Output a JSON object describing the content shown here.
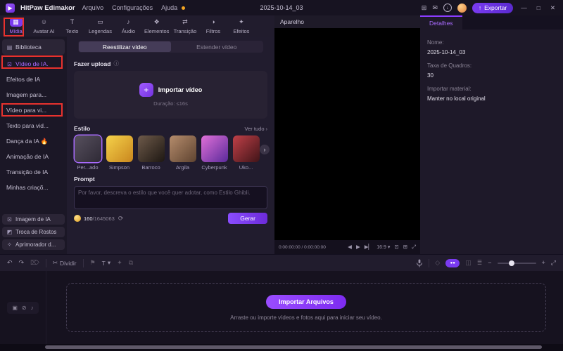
{
  "colors": {
    "accent": "#8b3dff",
    "annotation": "#e8322e",
    "export_button": "#6c3bd8"
  },
  "titlebar": {
    "app_name": "HitPaw Edimakor",
    "menu_items": [
      {
        "label": "Arquivo"
      },
      {
        "label": "Configurações"
      },
      {
        "label": "Ajuda"
      }
    ],
    "project_name": "2025-10-14_03",
    "export_label": "Exportar",
    "glyphs": {
      "logo": "▶",
      "grid": "⊞",
      "feedback": "✉",
      "download": "↓",
      "export_arrow": "↑",
      "minimize": "—",
      "maximize": "□",
      "close": "✕"
    }
  },
  "ribbon": {
    "tabs": [
      {
        "label": "Mídia",
        "glyph": "▦"
      },
      {
        "label": "Avatar AI",
        "glyph": "☺"
      },
      {
        "label": "Texto",
        "glyph": "T"
      },
      {
        "label": "Legendas",
        "glyph": "▭"
      },
      {
        "label": "Áudio",
        "glyph": "♪"
      },
      {
        "label": "Elementos",
        "glyph": "❖"
      },
      {
        "label": "Transição",
        "glyph": "⇄"
      },
      {
        "label": "Filtros",
        "glyph": "◑"
      },
      {
        "label": "Efeitos",
        "glyph": "✦"
      }
    ]
  },
  "sidebar": {
    "items": [
      {
        "label": "Biblioteca",
        "glyph": "▤"
      },
      {
        "label": "Vídeo de IA.",
        "glyph": "⊡"
      },
      {
        "label": "Efeitos de IA",
        "glyph": ""
      },
      {
        "label": "Imagem para...",
        "glyph": ""
      },
      {
        "label": "Vídeo para vi...",
        "glyph": ""
      },
      {
        "label": "Texto para vid...",
        "glyph": ""
      },
      {
        "label": "Dança da IA 🔥",
        "glyph": ""
      },
      {
        "label": "Animação de IA",
        "glyph": ""
      },
      {
        "label": "Transição de IA",
        "glyph": ""
      },
      {
        "label": "Minhas criaçõ...",
        "glyph": ""
      }
    ],
    "bottom_items": [
      {
        "label": "Imagem de IA",
        "glyph": "⊡"
      },
      {
        "label": "Troca de Rostos",
        "glyph": "◩"
      },
      {
        "label": "Aprimorador d...",
        "glyph": "✧"
      }
    ]
  },
  "panel": {
    "tabs": [
      {
        "label": "Reestilizar vídeo"
      },
      {
        "label": "Estender vídeo"
      }
    ],
    "upload_section": "Fazer upload",
    "info_glyph": "ⓘ",
    "import_video_label": "Importar vídeo",
    "plus_glyph": "+",
    "duration_hint": "Duração: ≤16s",
    "style_section": "Estilo",
    "see_all_label": "Ver tudo",
    "chevron_glyph": "›",
    "styles": [
      {
        "name": "Per...ado",
        "css": "background:linear-gradient(135deg,#57505e,#2e2935)"
      },
      {
        "name": "Simpson",
        "css": "background:linear-gradient(135deg,#f5d24a,#c9861e)"
      },
      {
        "name": "Barroco",
        "css": "background:linear-gradient(135deg,#6e5a4a,#1d1712)"
      },
      {
        "name": "Argila",
        "css": "background:linear-gradient(135deg,#b58c6c,#5e4330)"
      },
      {
        "name": "Cyberpunk",
        "css": "background:linear-gradient(135deg,#e070d8,#5a2a9a)"
      },
      {
        "name": "Uko...",
        "css": "background:linear-gradient(135deg,#c04048,#401418)"
      }
    ],
    "prompt_section": "Prompt",
    "prompt_placeholder": "Por favor, descreva o estilo que você quer adotar, como Estilo Ghibli.",
    "credits_used": "160",
    "credits_total": "/1645063",
    "refresh_glyph": "⟳",
    "generate_label": "Gerar"
  },
  "preview": {
    "title": "Aparelho",
    "timecode": "0:00:00:00 / 0:00:00:00",
    "glyphs": {
      "prev": "◀",
      "play": "▶",
      "next": "▶▏",
      "dropdown": "▾",
      "snapshot": "⊡",
      "grid": "⊞",
      "fullscreen": "⤢"
    },
    "aspect_label": "16:9"
  },
  "details": {
    "tab_label": "Detalhes",
    "fields": [
      {
        "label": "Nome:",
        "value": "2025-10-14_03"
      },
      {
        "label": "Taxa de Quadros:",
        "value": "30"
      },
      {
        "label": "Importar material:",
        "value": "Manter no local original"
      }
    ]
  },
  "timeline_toolbar": {
    "glyphs": {
      "undo": "↶",
      "redo": "↷",
      "trash": "⌦",
      "scissors": "✂",
      "flag": "⚑",
      "text_tool": "T",
      "dropdown": "▾",
      "magic": "✦",
      "crop": "⧉",
      "keyframe": "◇",
      "toggle_a": "●●",
      "track_view": "◫",
      "list_view": "≣",
      "zoom_out": "−",
      "zoom_in": "+",
      "fit": "⤢"
    },
    "split_label": "Dividir"
  },
  "timeline": {
    "track_glyphs": {
      "record": "▣",
      "mute": "⊘",
      "audio": "♪"
    },
    "import_button_label": "Importar Arquivos",
    "drop_hint": "Arraste ou importe vídeos e fotos aqui para iniciar seu vídeo."
  }
}
